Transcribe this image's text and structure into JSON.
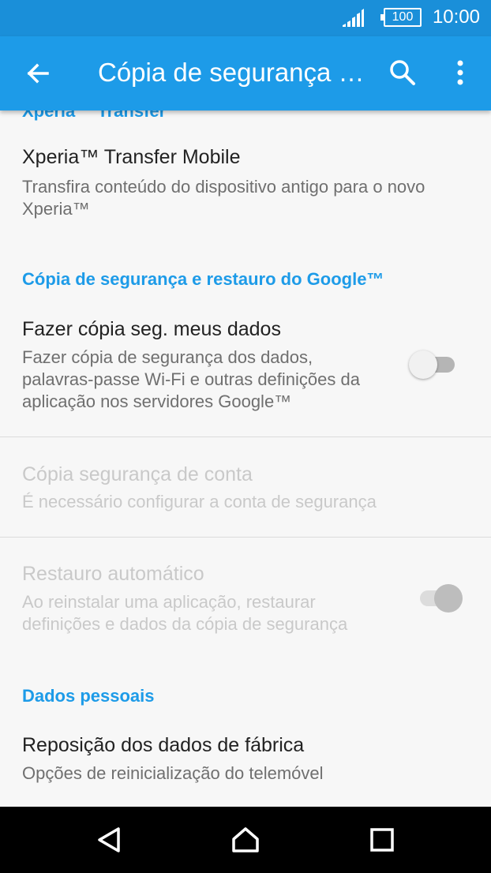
{
  "status_bar": {
    "battery_level": "100",
    "time": "10:00",
    "icons": [
      "signal-icon",
      "battery-icon"
    ]
  },
  "app_bar": {
    "title": "Cópia de segurança e restauro",
    "icons": [
      "back-arrow-icon",
      "search-icon",
      "more-vert-icon"
    ]
  },
  "sections": {
    "xperia_transfer": {
      "header": "Xperia™ Transfer",
      "item_title": "Xperia™ Transfer Mobile",
      "item_subtitle": "Transfira conteúdo do dispositivo antigo para o novo Xperia™"
    },
    "google_backup": {
      "header": "Cópia de segurança e restauro do Google™",
      "backup_data": {
        "title": "Fazer cópia seg. meus dados",
        "subtitle": "Fazer cópia de segurança dos dados, palavras-passe Wi-Fi e outras definições da aplicação nos servidores Google™",
        "toggle_state": "off"
      },
      "backup_account": {
        "title": "Cópia segurança de conta",
        "subtitle": "É necessário configurar a conta de segurança",
        "enabled": false
      },
      "auto_restore": {
        "title": "Restauro automático",
        "subtitle": "Ao reinstalar uma aplicação, restaurar definições e dados da cópia de segurança",
        "toggle_state": "on",
        "enabled": false
      }
    },
    "personal_data": {
      "header": "Dados pessoais",
      "factory_reset": {
        "title": "Reposição dos dados de fábrica",
        "subtitle": "Opções de reinicialização do telemóvel"
      }
    }
  },
  "nav_bar": {
    "icons": [
      "back-triangle-icon",
      "home-icon",
      "recents-icon"
    ]
  },
  "colors": {
    "status_bar": "#1a8fd9",
    "app_bar": "#1d9be8",
    "accent": "#1d9be8",
    "background": "#f7f7f7",
    "nav_bar": "#000000"
  }
}
